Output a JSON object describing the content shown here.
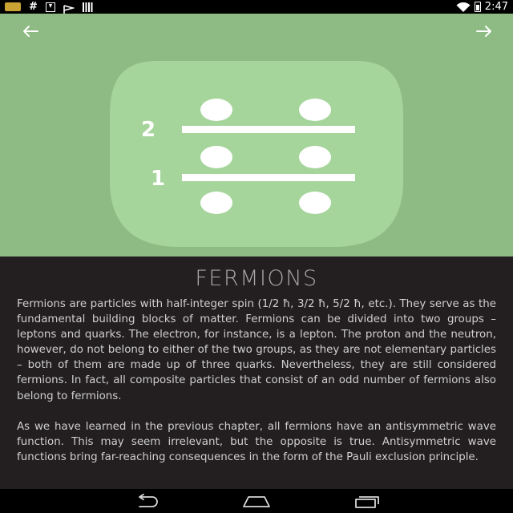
{
  "status_bar": {
    "time": "2:47",
    "left_icons": [
      "app-icon",
      "hash-icon",
      "download-icon",
      "flag-icon",
      "barcode-icon"
    ],
    "right_icons": [
      "wifi-icon",
      "battery-icon"
    ]
  },
  "header": {
    "background_color": "#8dbb83",
    "illustration_color": "#a6d59c",
    "back_icon": "arrow-left-icon",
    "forward_icon": "arrow-right-icon",
    "level_labels": [
      "2",
      "1"
    ]
  },
  "content": {
    "title": "FERMIONS",
    "paragraphs": [
      "Fermions are particles with half-integer spin (1/2 ħ, 3/2 ħ, 5/2 ħ, etc.). They serve as the fundamental building blocks of matter. Fermions can be divided into two groups – leptons and quarks. The electron, for instance, is a lepton. The proton and the neutron, however, do not belong to either of the two groups, as they are not elementary particles – both of them are made up of three quarks. Nevertheless, they are still considered fermions. In fact, all composite particles that consist of an odd number of fermions also belong to fermions.",
      "As we have learned in the previous chapter, all fermions have an antisymmetric wave function. This may seem irrelevant, but the opposite is true. Antisymmetric wave functions bring far-reaching consequences in the form of the Pauli exclusion principle."
    ]
  },
  "nav_bar": {
    "buttons": [
      "back-icon",
      "home-icon",
      "recent-apps-icon"
    ]
  }
}
